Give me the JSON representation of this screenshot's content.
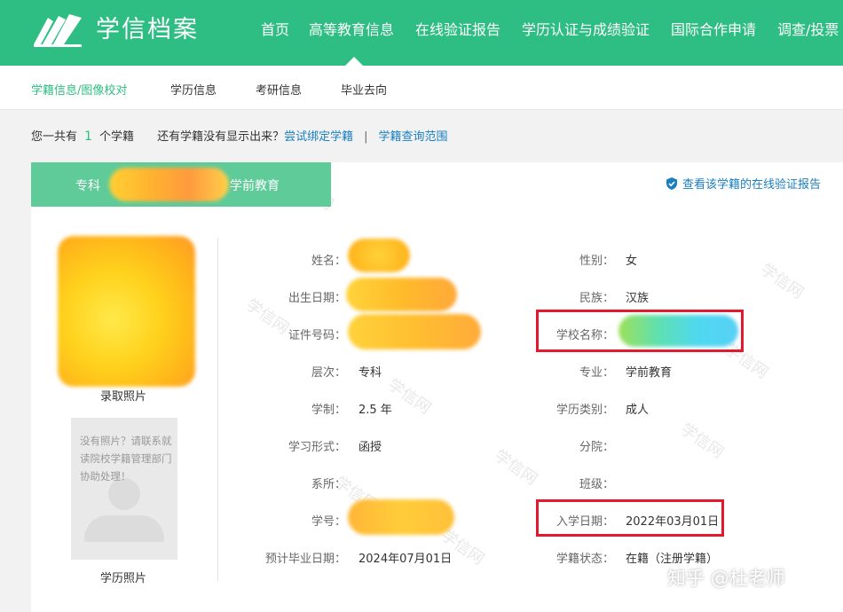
{
  "header": {
    "logo_text": "学信档案",
    "nav": [
      "首页",
      "高等教育信息",
      "在线验证报告",
      "学历认证与成绩验证",
      "国际合作申请",
      "调查/投票"
    ]
  },
  "subnav": [
    "学籍信息/图像校对",
    "学历信息",
    "考研信息",
    "毕业去向"
  ],
  "infoline": {
    "prefix": "您一共有",
    "count": "1",
    "suffix": "个学籍",
    "question": "还有学籍没有显示出来？",
    "bind_link": "尝试绑定学籍",
    "separator": "|",
    "scope_link": "学籍查询范围"
  },
  "record": {
    "tab_level": "专科",
    "tab_major": "学前教育",
    "verify_link": "查看该学籍的在线验证报告",
    "photo_caption": "录取照片",
    "nophoto_text": "没有照片？请联系就读院校学籍管理部门协助处理！",
    "photo2_caption": "学历照片",
    "fields_left": [
      {
        "label": "姓名：",
        "value": ""
      },
      {
        "label": "出生日期：",
        "value": ""
      },
      {
        "label": "证件号码：",
        "value": ""
      },
      {
        "label": "层次：",
        "value": "专科"
      },
      {
        "label": "学制：",
        "value": "2.5 年"
      },
      {
        "label": "学习形式：",
        "value": "函授"
      },
      {
        "label": "系所：",
        "value": ""
      },
      {
        "label": "学号：",
        "value": ""
      },
      {
        "label": "预计毕业日期：",
        "value": "2024年07月01日"
      }
    ],
    "fields_right": [
      {
        "label": "性别：",
        "value": "女"
      },
      {
        "label": "民族：",
        "value": "汉族"
      },
      {
        "label": "学校名称：",
        "value": ""
      },
      {
        "label": "专业：",
        "value": "学前教育"
      },
      {
        "label": "学历类别：",
        "value": "成人"
      },
      {
        "label": "分院：",
        "value": ""
      },
      {
        "label": "班级：",
        "value": ""
      },
      {
        "label": "入学日期：",
        "value": "2022年03月01日"
      },
      {
        "label": "学籍状态：",
        "value": "在籍（注册学籍）"
      }
    ]
  },
  "watermark_text": "学信网",
  "overlay_credit": "知乎 @杜老师",
  "colors": {
    "brand_green": "#2ebd82",
    "tab_green": "#5fcb99",
    "link_blue": "#1a7fc1",
    "highlight_red": "#e3192e"
  }
}
